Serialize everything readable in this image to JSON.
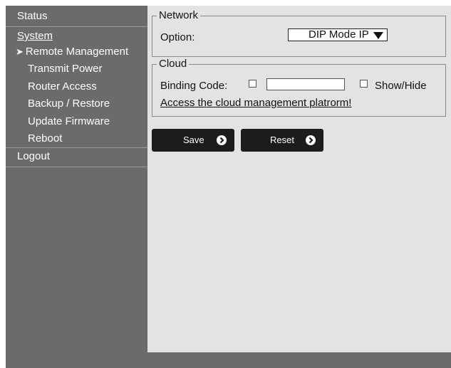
{
  "sidebar": {
    "status": "Status",
    "system": "System",
    "items": [
      {
        "label": "Remote Management",
        "active": true
      },
      {
        "label": "Transmit Power"
      },
      {
        "label": "Router Access"
      },
      {
        "label": "Backup / Restore"
      },
      {
        "label": "Update Firmware"
      },
      {
        "label": "Reboot"
      }
    ],
    "logout": "Logout"
  },
  "network": {
    "legend": "Network",
    "option_label": "Option:",
    "option_value": "DIP Mode IP"
  },
  "cloud": {
    "legend": "Cloud",
    "binding_code_label": "Binding Code:",
    "binding_code_value": "",
    "binding_checked": false,
    "show_hide_label": "Show/Hide",
    "show_hide_checked": false,
    "link_text": "Access the cloud management platrorm!"
  },
  "buttons": {
    "save": "Save",
    "reset": "Reset"
  },
  "colors": {
    "sidebar_bg": "#6b6b6b",
    "main_bg": "#e3e3e3",
    "button_bg": "#1c1c1c"
  }
}
